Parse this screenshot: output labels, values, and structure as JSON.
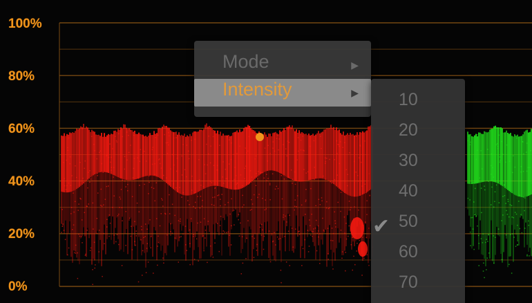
{
  "scope": {
    "y_axis_labels": [
      "100%",
      "80%",
      "60%",
      "40%",
      "20%",
      "0%"
    ],
    "colors": {
      "grid": "#7a4a12",
      "axis_label": "#f0941c",
      "red_channel": "#ff1a10",
      "green_channel": "#22e41c",
      "marker": "#f0941c"
    }
  },
  "context_menu": {
    "items": [
      {
        "label": "Mode",
        "arrow": "▶"
      },
      {
        "label": "Intensity",
        "arrow": "▶"
      }
    ]
  },
  "intensity_submenu": {
    "check_mark": "✔",
    "options": [
      "10",
      "20",
      "30",
      "40",
      "50",
      "60",
      "70"
    ],
    "selected": "50"
  }
}
